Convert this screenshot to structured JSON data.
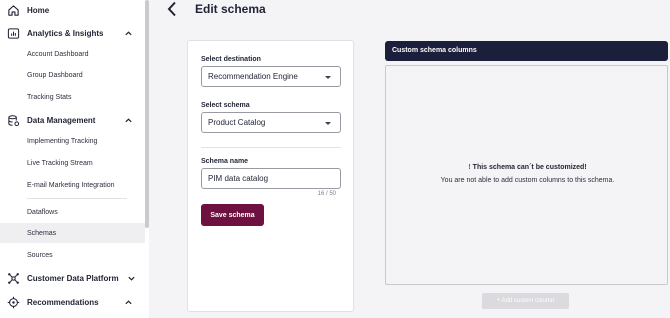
{
  "sidebar": {
    "home": {
      "label": "Home",
      "icon": "home-icon"
    },
    "analytics": {
      "label": "Analytics & Insights",
      "icon": "analytics-icon",
      "items": [
        {
          "label": "Account Dashboard"
        },
        {
          "label": "Group Dashboard"
        },
        {
          "label": "Tracking Stats"
        }
      ]
    },
    "data_management": {
      "label": "Data Management",
      "icon": "database-icon",
      "items": [
        {
          "label": "Implementing Tracking"
        },
        {
          "label": "Live Tracking Stream"
        },
        {
          "label": "E-mail Marketing Integration"
        },
        {
          "label": "Dataflows"
        },
        {
          "label": "Schemas",
          "active": true
        },
        {
          "label": "Sources"
        }
      ]
    },
    "cdp": {
      "label": "Customer Data Platform",
      "icon": "network-icon"
    },
    "recommendations": {
      "label": "Recommendations",
      "icon": "target-icon"
    }
  },
  "header": {
    "title": "Edit schema"
  },
  "form": {
    "destination_label": "Select destination",
    "destination_value": "Recommendation Engine",
    "schema_label": "Select schema",
    "schema_value": "Product Catalog",
    "name_label": "Schema name",
    "name_value": "PIM data catalog",
    "char_count": "16 / 50",
    "save_label": "Save schema"
  },
  "custom_columns": {
    "title": "Custom schema columns",
    "warning_mark": "!",
    "warning_text": "This schema can´t be customized!",
    "info_text": "You are not able to add custom columns to this schema.",
    "add_label": "+ Add custom column"
  },
  "colors": {
    "accent": "#6e1040",
    "header_dark": "#1c1f3b",
    "warning": "#d7262f"
  }
}
